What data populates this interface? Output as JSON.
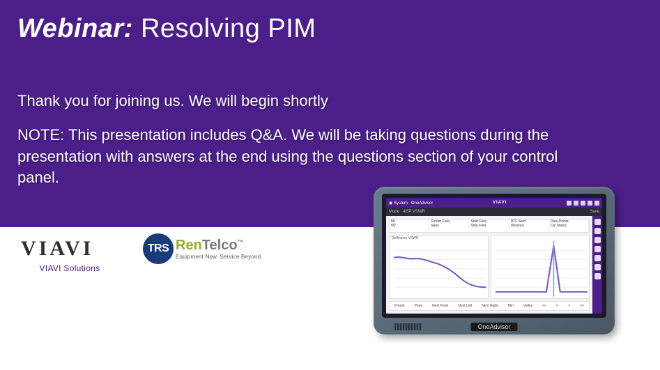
{
  "title": {
    "prefix": "Webinar:",
    "main": "Resolving PIM"
  },
  "body": {
    "intro": "Thank you for joining us. We will begin shortly",
    "note": "NOTE: This presentation includes Q&A. We will be taking questions during the presentation with answers at the end using the questions section of your control panel."
  },
  "logos": {
    "viavi": {
      "word": "VIAVI",
      "sub": "VIAVI Solutions"
    },
    "trs": {
      "circle": "TRS",
      "ren": "Ren",
      "telco": "Telco",
      "tm": "™",
      "sub": "Equipment Now. Service Beyond."
    }
  },
  "device": {
    "brand": "VIAVI",
    "model": "OneAdvisor",
    "chart1_title": "Reflection VSWR",
    "bottom_labels": [
      "Preset",
      "Peak",
      "Next Peak",
      "Next Left",
      "Next Right",
      "Min",
      "Valley",
      "<<",
      "<",
      ">",
      ">>"
    ]
  }
}
